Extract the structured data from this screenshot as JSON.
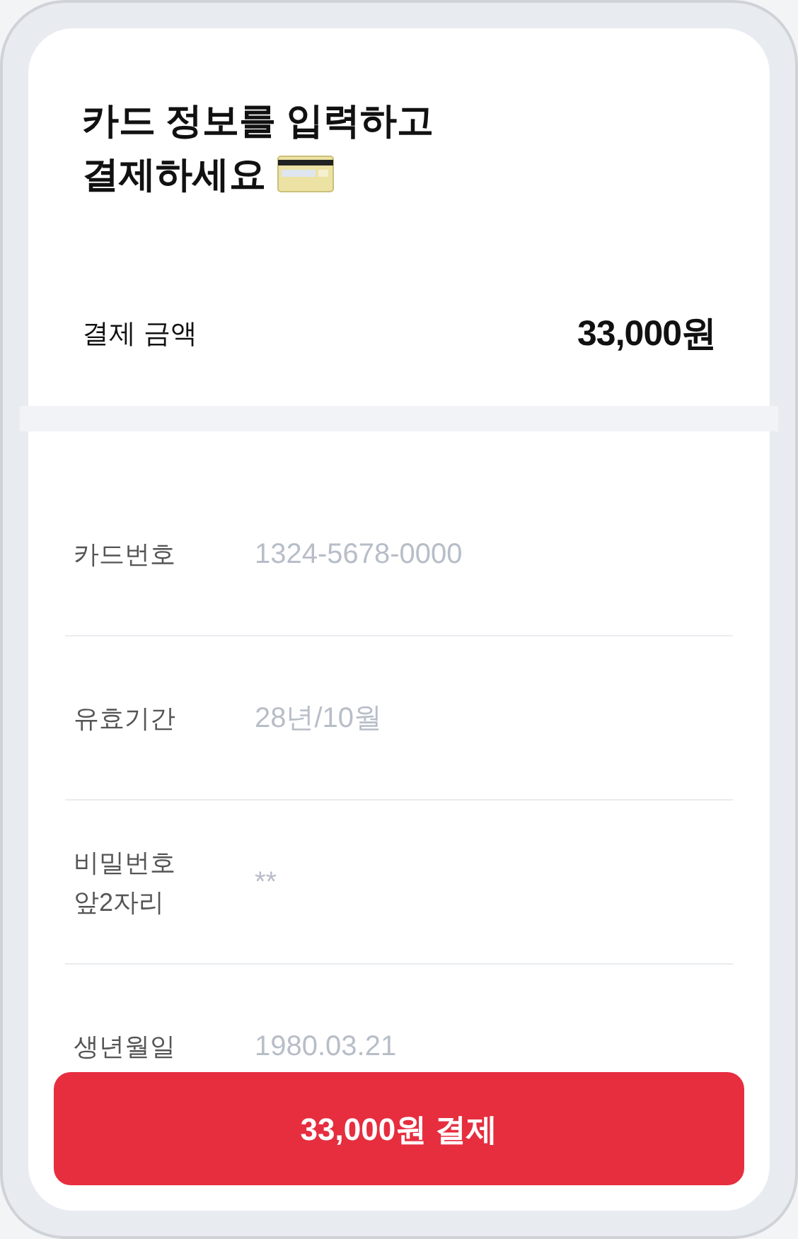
{
  "title": {
    "lines": [
      "카드 정보를 입력하고",
      "결제하세요"
    ]
  },
  "amount": {
    "label": "결제 금액",
    "value": "33,000원"
  },
  "fields": [
    {
      "label": [
        "카드번호"
      ],
      "placeholder": "1324-5678-0000"
    },
    {
      "label": [
        "유효기간"
      ],
      "placeholder": "28년/10월"
    },
    {
      "label": [
        "비밀번호",
        "앞2자리"
      ],
      "placeholder": "**"
    },
    {
      "label": [
        "생년월일"
      ],
      "placeholder": "1980.03.21"
    }
  ],
  "pay_button": "33,000원 결제"
}
